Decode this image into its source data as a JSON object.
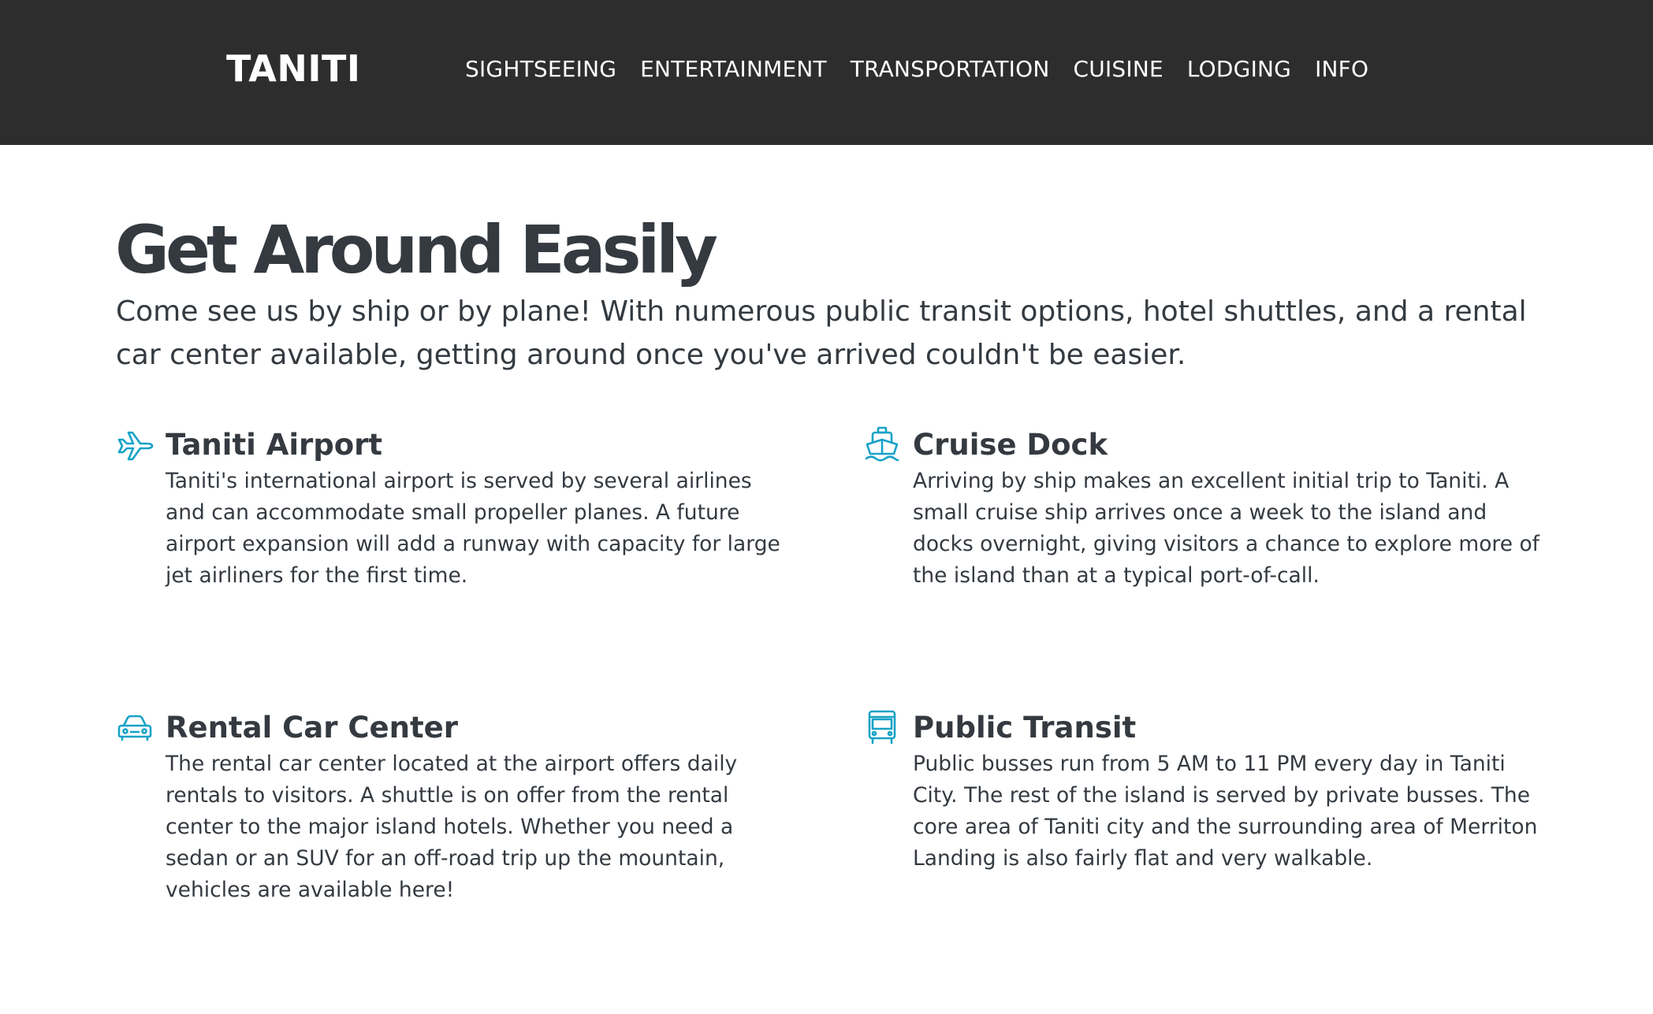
{
  "nav": {
    "brand": "TANITI",
    "links": [
      "SIGHTSEEING",
      "ENTERTAINMENT",
      "TRANSPORTATION",
      "CUISINE",
      "LODGING",
      "INFO"
    ]
  },
  "hero": {
    "title": "Get Around Easily",
    "lead": "Come see us by ship or by plane! With numerous public transit options, hotel shuttles, and a rental car center available, getting around once you've arrived couldn't be easier."
  },
  "features": [
    {
      "icon": "airplane-icon",
      "title": "Taniti Airport",
      "text": "Taniti's international airport is served by several airlines and can accommodate small propeller planes. A future airport expansion will add a runway with capacity for large jet airliners for the first time."
    },
    {
      "icon": "ship-icon",
      "title": "Cruise Dock",
      "text": "Arriving by ship makes an excellent initial trip to Taniti. A small cruise ship arrives once a week to the island and docks overnight, giving visitors a chance to explore more of the island than at a typical port-of-call."
    },
    {
      "icon": "car-icon",
      "title": "Rental Car Center",
      "text": "The rental car center located at the airport offers daily rentals to visitors. A shuttle is on offer from the rental center to the major island hotels. Whether you need a sedan or an SUV for an off-road trip up the mountain, vehicles are available here!"
    },
    {
      "icon": "bus-icon",
      "title": "Public Transit",
      "text": "Public busses run from 5 AM to 11 PM every day in Taniti City. The rest of the island is served by private busses. The core area of Taniti city and the surrounding area of Merriton Landing is also fairly flat and very walkable."
    }
  ],
  "colors": {
    "navbar_bg": "#2d2d2d",
    "icon_accent": "#17a2c7",
    "text": "#343a40"
  }
}
